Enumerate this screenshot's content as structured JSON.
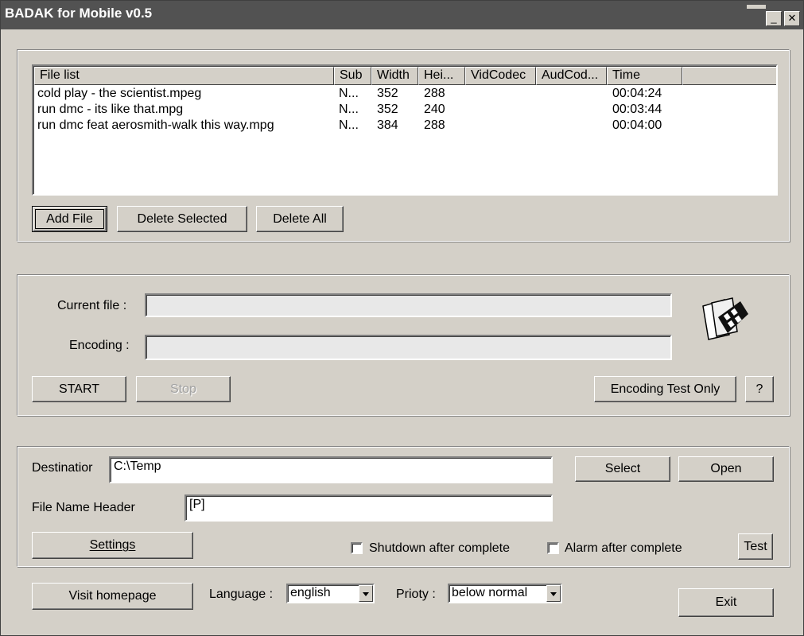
{
  "window": {
    "title": "BADAK for Mobile v0.5",
    "min_glyph": "_",
    "close_glyph": "✕"
  },
  "file_list": {
    "columns": [
      "File list",
      "Sub",
      "Width",
      "Hei...",
      "VidCodec",
      "AudCod...",
      "Time"
    ],
    "rows": [
      {
        "name": "cold play - the scientist.mpeg",
        "sub": "N...",
        "width": "352",
        "height": "288",
        "vidcodec": "",
        "audcodec": "",
        "time": "00:04:24"
      },
      {
        "name": "run dmc - its like that.mpg",
        "sub": "N...",
        "width": "352",
        "height": "240",
        "vidcodec": "",
        "audcodec": "",
        "time": "00:03:44"
      },
      {
        "name": "run dmc feat aerosmith-walk this way.mpg",
        "sub": "N...",
        "width": "384",
        "height": "288",
        "vidcodec": "",
        "audcodec": "",
        "time": "00:04:00"
      }
    ],
    "add_file": "Add File",
    "delete_selected": "Delete Selected",
    "delete_all": "Delete All"
  },
  "encode": {
    "current_file_label": "Current file :",
    "current_file_value": "",
    "encoding_label": "Encoding :",
    "encoding_value": "",
    "start": "START",
    "stop": "Stop",
    "test_only": "Encoding Test Only",
    "help": "?",
    "icon": "film-reel-icon"
  },
  "output": {
    "destination_label": "Destinatior",
    "destination_value": "C:\\Temp",
    "select": "Select",
    "open": "Open",
    "header_label": "File Name Header",
    "header_value": "[P]",
    "settings": "Settings",
    "shutdown_label": "Shutdown after complete",
    "alarm_label": "Alarm after complete",
    "test": "Test"
  },
  "footer": {
    "visit": "Visit homepage",
    "language_label": "Language :",
    "language_value": "english",
    "priority_label": "Prioty :",
    "priority_value": "below normal",
    "exit": "Exit"
  }
}
